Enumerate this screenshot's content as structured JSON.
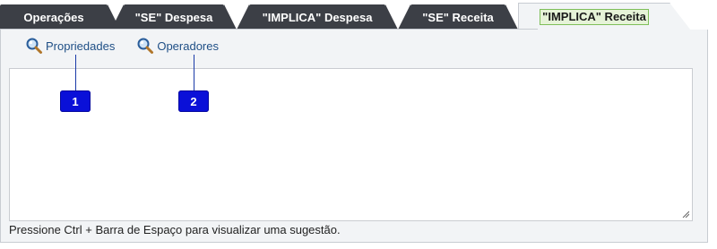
{
  "tabs": [
    {
      "label": "Operações",
      "active": false
    },
    {
      "label": "\"SE\" Despesa",
      "active": false
    },
    {
      "label": "\"IMPLICA\" Despesa",
      "active": false
    },
    {
      "label": "\"SE\" Receita",
      "active": false
    },
    {
      "label": "\"IMPLICA\" Receita",
      "active": true
    }
  ],
  "toolbar": {
    "propriedades_label": "Propriedades",
    "operadores_label": "Operadores",
    "icon": "magnifier-icon"
  },
  "editor": {
    "value": ""
  },
  "hint": "Pressione Ctrl + Barra de Espaço para visualizar uma sugestão.",
  "callouts": [
    "1",
    "2"
  ],
  "colors": {
    "tab_dark": "#3c3f46",
    "panel_bg": "#f2f4f6",
    "active_tab_highlight": "#e6f3d8",
    "active_tab_border": "#7fbf5a",
    "link": "#1f4f86",
    "callout": "#0a10d8"
  }
}
